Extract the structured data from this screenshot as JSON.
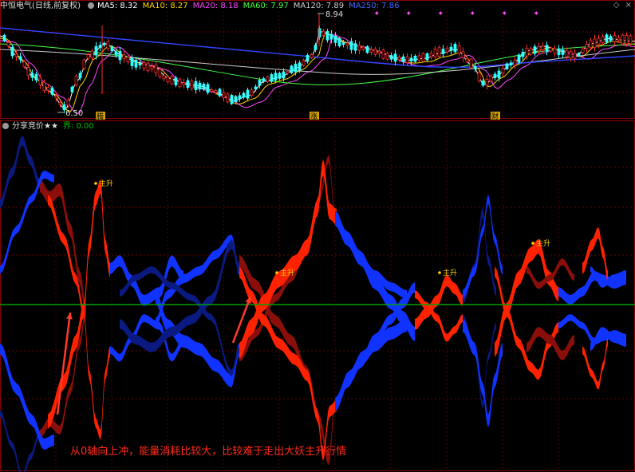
{
  "header": {
    "title": "中恒电气(日线,前复权)",
    "indicators": [
      {
        "label": "MA5: 8.32",
        "color": "#ffffff"
      },
      {
        "label": "MA10: 8.27",
        "color": "#ffd500"
      },
      {
        "label": "MA20: 8.18",
        "color": "#ff44ff"
      },
      {
        "label": "MA60: 7.97",
        "color": "#44ff44"
      },
      {
        "label": "MA120: 7.89",
        "color": "#cccccc"
      },
      {
        "label": "MA250: 7.86",
        "color": "#4466ff"
      }
    ],
    "corner_icons": [
      "diamond-icon",
      "close-icon"
    ]
  },
  "sub_header": {
    "title": "分享竞价★★",
    "value_label": "界: 0.00",
    "value_color": "#00c000"
  },
  "annotations": {
    "high_price": "8.94",
    "low_price": "6.50",
    "markers": [
      "腾",
      "涨",
      "财"
    ],
    "signal_label": "主升",
    "caption": "从0轴向上冲，能量消耗比较大，比较难于走出大妖主升行情"
  },
  "chart_data": [
    {
      "type": "candlestick",
      "price_high": 8.94,
      "price_low": 6.5,
      "moving_averages": [
        "MA5",
        "MA10",
        "MA20",
        "MA60",
        "MA120",
        "MA250"
      ]
    },
    {
      "type": "area",
      "zero_line": 0,
      "signals": [
        "主升",
        "主升",
        "主升",
        "主升"
      ]
    }
  ],
  "colors": {
    "up": "#ff2200",
    "down": "#1133ff",
    "dark_up": "#8a0f0a",
    "dark_down": "#0a1a80",
    "zero_line": "#00a000",
    "grid": "#8b0000"
  }
}
